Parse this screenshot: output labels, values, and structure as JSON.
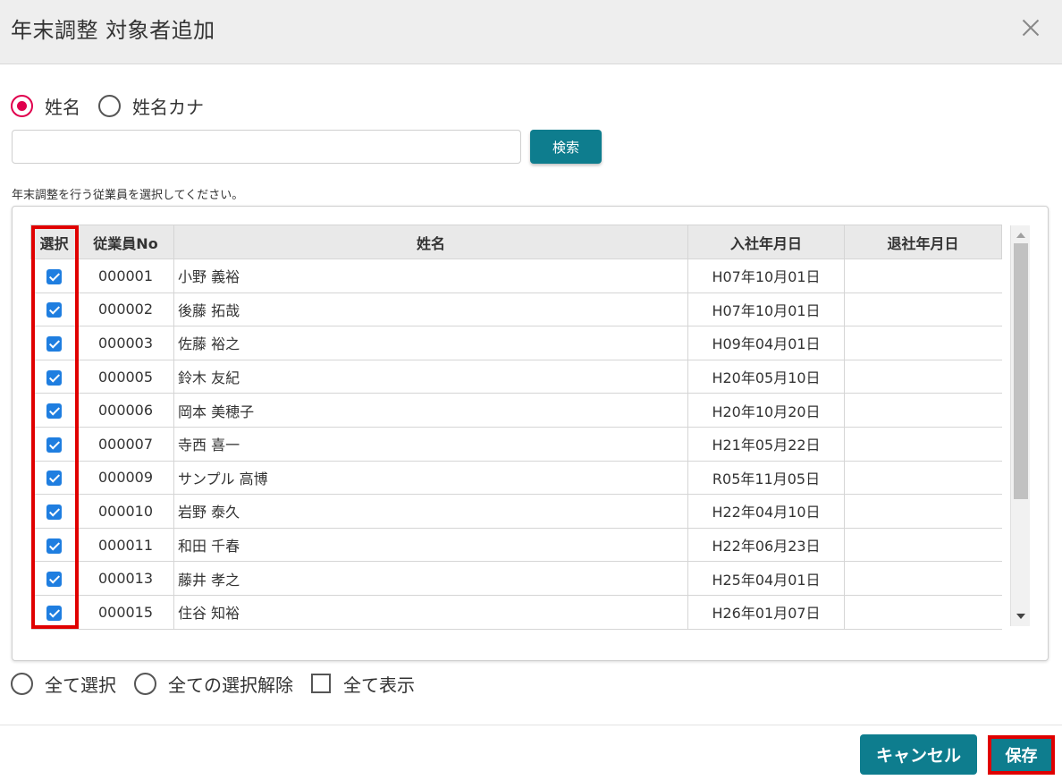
{
  "dialog": {
    "title": "年末調整 対象者追加",
    "close_icon": "close-icon"
  },
  "search": {
    "mode_options": [
      {
        "label": "姓名",
        "selected": true
      },
      {
        "label": "姓名カナ",
        "selected": false
      }
    ],
    "input_value": "",
    "button_label": "検索"
  },
  "instruction": "年末調整を行う従業員を選択してください。",
  "table": {
    "columns": [
      "選択",
      "従業員No",
      "姓名",
      "入社年月日",
      "退社年月日"
    ],
    "rows": [
      {
        "checked": true,
        "no": "000001",
        "name": "小野 義裕",
        "joined": "H07年10月01日",
        "left": ""
      },
      {
        "checked": true,
        "no": "000002",
        "name": "後藤 拓哉",
        "joined": "H07年10月01日",
        "left": ""
      },
      {
        "checked": true,
        "no": "000003",
        "name": "佐藤 裕之",
        "joined": "H09年04月01日",
        "left": ""
      },
      {
        "checked": true,
        "no": "000005",
        "name": "鈴木 友紀",
        "joined": "H20年05月10日",
        "left": ""
      },
      {
        "checked": true,
        "no": "000006",
        "name": "岡本 美穂子",
        "joined": "H20年10月20日",
        "left": ""
      },
      {
        "checked": true,
        "no": "000007",
        "name": "寺西 喜一",
        "joined": "H21年05月22日",
        "left": ""
      },
      {
        "checked": true,
        "no": "000009",
        "name": "サンプル 高博",
        "joined": "R05年11月05日",
        "left": ""
      },
      {
        "checked": true,
        "no": "000010",
        "name": "岩野 泰久",
        "joined": "H22年04月10日",
        "left": ""
      },
      {
        "checked": true,
        "no": "000011",
        "name": "和田 千春",
        "joined": "H22年06月23日",
        "left": ""
      },
      {
        "checked": true,
        "no": "000013",
        "name": "藤井 孝之",
        "joined": "H25年04月01日",
        "left": ""
      },
      {
        "checked": true,
        "no": "000015",
        "name": "住谷 知裕",
        "joined": "H26年01月07日",
        "left": ""
      }
    ]
  },
  "bulk_options": {
    "select_all": "全て選択",
    "deselect_all": "全ての選択解除",
    "show_all": "全て表示"
  },
  "footer": {
    "cancel_label": "キャンセル",
    "save_label": "保存"
  },
  "colors": {
    "accent": "#0e7d8e",
    "radio_selected": "#e0004d",
    "checkbox": "#1f7ee0",
    "highlight": "#e00000"
  }
}
